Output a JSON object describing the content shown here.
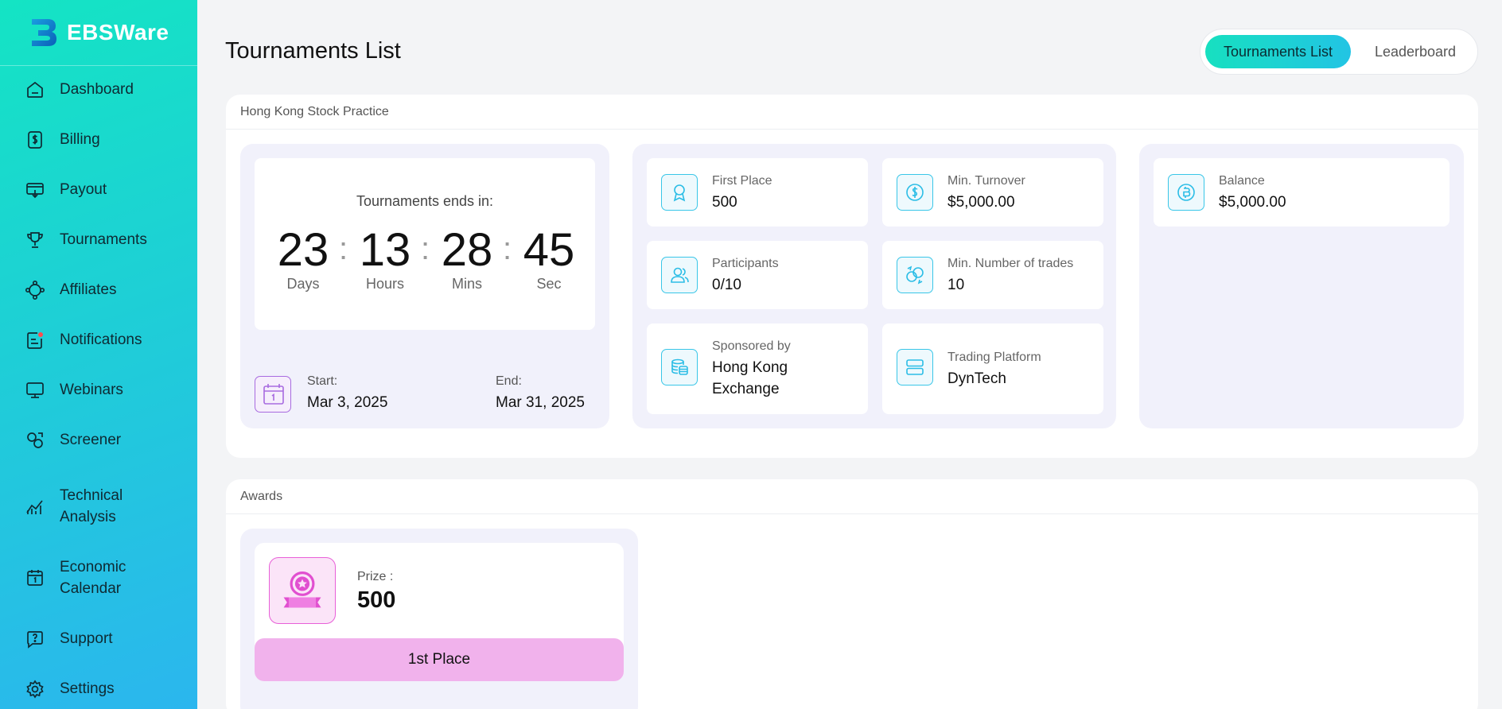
{
  "sidebar": {
    "brand": "EBSWare",
    "items": [
      {
        "label": "Dashboard",
        "icon": "home-icon"
      },
      {
        "label": "Billing",
        "icon": "dollar-doc-icon"
      },
      {
        "label": "Payout",
        "icon": "payout-icon"
      },
      {
        "label": "Tournaments",
        "icon": "trophy-icon"
      },
      {
        "label": "Affiliates",
        "icon": "network-icon"
      },
      {
        "label": "Notifications",
        "icon": "notification-icon"
      },
      {
        "label": "Webinars",
        "icon": "monitor-icon"
      },
      {
        "label": "Screener",
        "icon": "screener-icon"
      },
      {
        "label": "Technical",
        "label2": "Analysis",
        "icon": "chart-icon"
      },
      {
        "label": "Economic",
        "label2": "Calendar",
        "icon": "calendar-icon"
      },
      {
        "label": "Support",
        "icon": "support-icon"
      },
      {
        "label": "Settings",
        "icon": "gear-icon"
      }
    ]
  },
  "header": {
    "title": "Tournaments List",
    "tabs": [
      {
        "label": "Tournaments List",
        "active": true
      },
      {
        "label": "Leaderboard",
        "active": false
      }
    ]
  },
  "tournament": {
    "name": "Hong Kong Stock Practice",
    "countdown": {
      "title": "Tournaments ends in:",
      "days": "23",
      "hours": "13",
      "mins": "28",
      "sec": "45",
      "days_label": "Days",
      "hours_label": "Hours",
      "mins_label": "Mins",
      "sec_label": "Sec"
    },
    "start_label": "Start:",
    "start_value": "Mar 3, 2025",
    "end_label": "End:",
    "end_value": "Mar 31, 2025",
    "info": {
      "first_place": {
        "label": "First Place",
        "value": "500"
      },
      "min_turnover": {
        "label": "Min. Turnover",
        "value": "$5,000.00"
      },
      "participants": {
        "label": "Participants",
        "value": "0/10"
      },
      "min_trades": {
        "label": "Min. Number of trades",
        "value": "10"
      },
      "sponsored": {
        "label": "Sponsored by",
        "value_line1": "Hong Kong",
        "value_line2": "Exchange"
      },
      "platform": {
        "label": "Trading Platform",
        "value": "DynTech"
      },
      "balance": {
        "label": "Balance",
        "value": "$5,000.00"
      }
    }
  },
  "awards": {
    "title": "Awards",
    "prize_label": "Prize :",
    "prize_value": "500",
    "place_label": "1st Place"
  },
  "colors": {
    "accent_start": "#14e4c4",
    "accent_end": "#2bb6ee",
    "award_pink": "#f1b2ec"
  }
}
